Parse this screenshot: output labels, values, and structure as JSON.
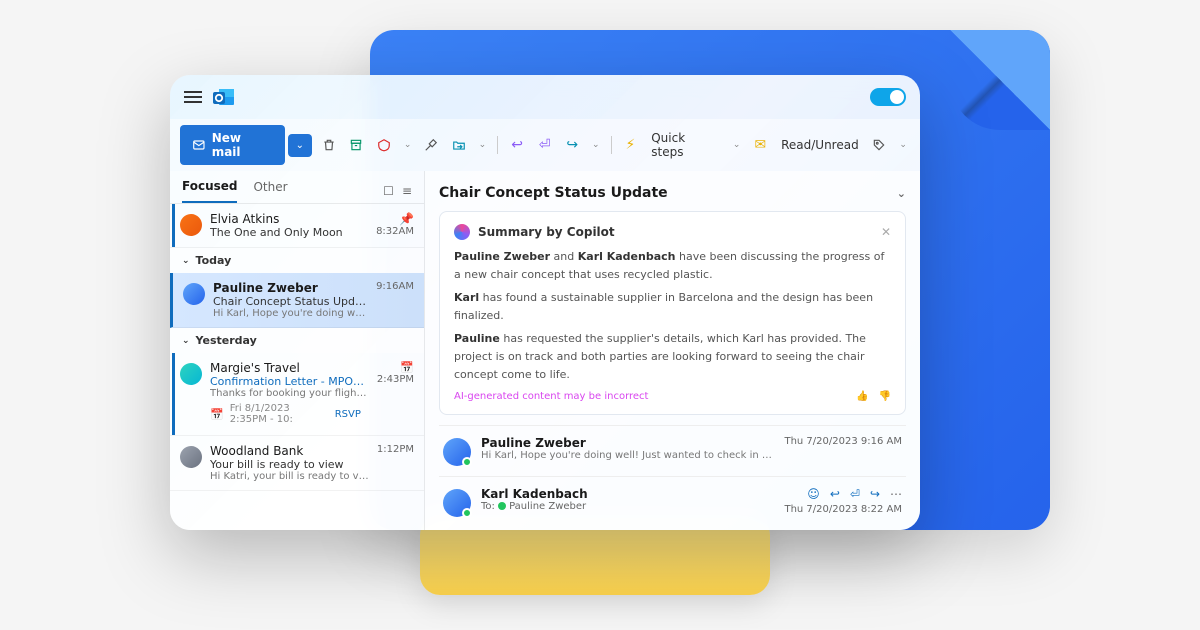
{
  "toolbar": {
    "new_mail": "New mail",
    "quick_steps": "Quick steps",
    "read_unread": "Read/Unread"
  },
  "tabs": {
    "focused": "Focused",
    "other": "Other"
  },
  "groups": {
    "today": "Today",
    "yesterday": "Yesterday"
  },
  "emails": {
    "e0": {
      "from": "Elvia Atkins",
      "subject": "The One and Only Moon",
      "time": "8:32AM"
    },
    "e1": {
      "from": "Pauline Zweber",
      "subject": "Chair Concept Status Update",
      "preview": "Hi Karl, Hope you're doing well!",
      "time": "9:16AM"
    },
    "e2": {
      "from": "Margie's Travel",
      "subject": "Confirmation Letter - MPOWMQ",
      "preview": "Thanks for booking your flight with Mar...",
      "time": "2:43PM",
      "rsvp_time": "Fri 8/1/2023 2:35PM - 10:",
      "rsvp": "RSVP"
    },
    "e3": {
      "from": "Woodland Bank",
      "subject": "Your bill is ready to view",
      "preview": "Hi Katri, your bill is ready to view. Log in...",
      "time": "1:12PM"
    }
  },
  "reading": {
    "subject": "Chair Concept Status Update",
    "copilot_title": "Summary by Copilot",
    "copilot_p1_a": "Pauline Zweber",
    "copilot_p1_b": " and ",
    "copilot_p1_c": "Karl Kadenbach",
    "copilot_p1_d": " have been discussing the progress of a new chair concept that uses recycled plastic.",
    "copilot_p2_a": "Karl",
    "copilot_p2_b": " has found a sustainable supplier in Barcelona and the design has been finalized.",
    "copilot_p3_a": "Pauline",
    "copilot_p3_b": " has requested the supplier's details, which Karl has provided. The project is on track and both parties are looking forward to seeing the chair concept come to life.",
    "disclaimer": "AI-generated content may be incorrect",
    "msg1": {
      "name": "Pauline Zweber",
      "preview": "Hi Karl, Hope you're doing well!  Just wanted to check in on the progres...",
      "date": "Thu 7/20/2023 9:16 AM"
    },
    "msg2": {
      "name": "Karl Kadenbach",
      "to_label": "To:",
      "to": "Pauline Zweber",
      "date": "Thu 7/20/2023 8:22 AM"
    }
  }
}
